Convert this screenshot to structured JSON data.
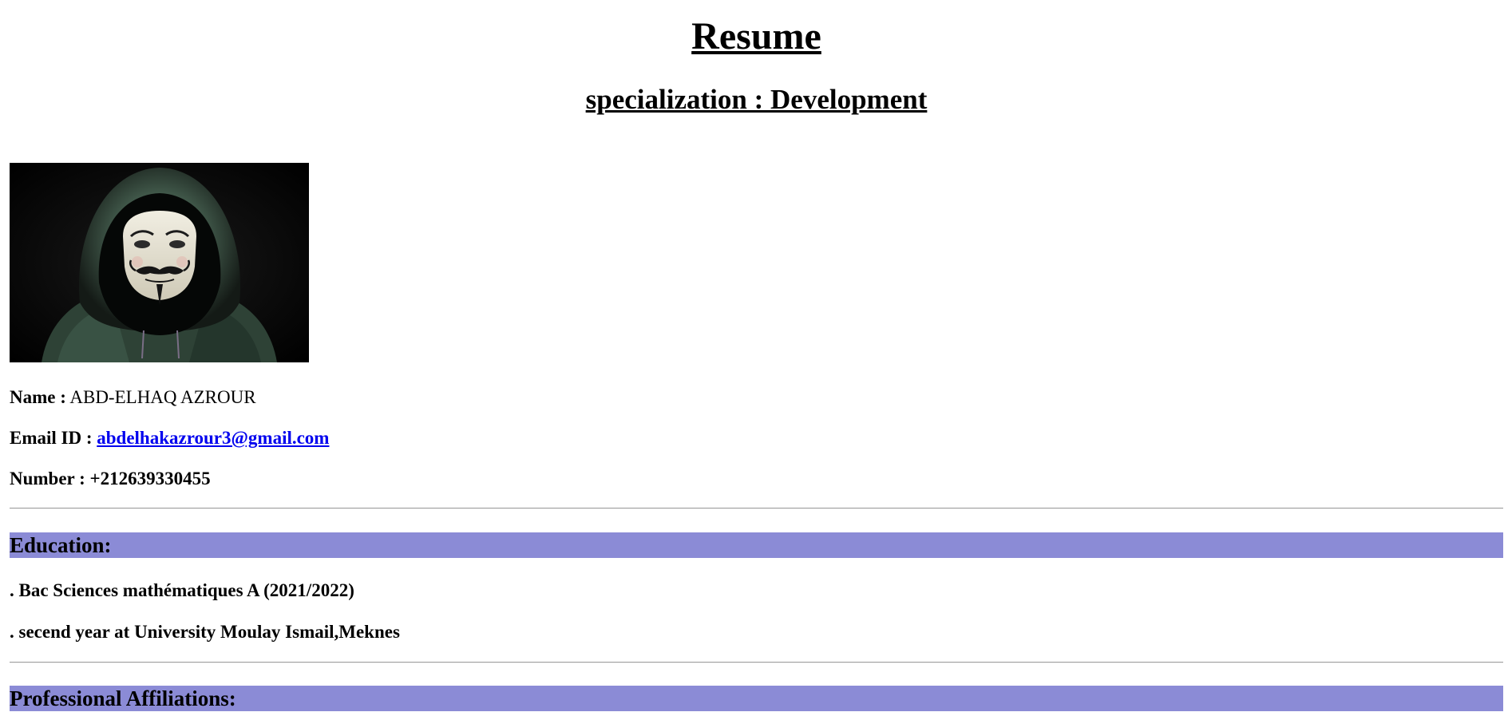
{
  "header": {
    "title": "Resume",
    "specialization": "specialization : Development"
  },
  "profile": {
    "photo_icon": "anonymous-mask-hoodie-photo",
    "name_label": "Name :",
    "name_value": "ABD-ELHAQ AZROUR",
    "email_label": "Email ID :",
    "email_value": "abdelhakazrour3@gmail.com",
    "number_label": "Number :",
    "number_value": "+212639330455"
  },
  "education": {
    "heading": "Education:",
    "items": [
      ". Bac Sciences mathématiques A (2021/2022)",
      ". secend year at University Moulay Ismail,Meknes"
    ]
  },
  "affiliations": {
    "heading": "Professional Affiliations:"
  },
  "colors": {
    "section_bg": "#8b8bd6",
    "link": "#0000ee",
    "rule": "#a0a0a0"
  }
}
